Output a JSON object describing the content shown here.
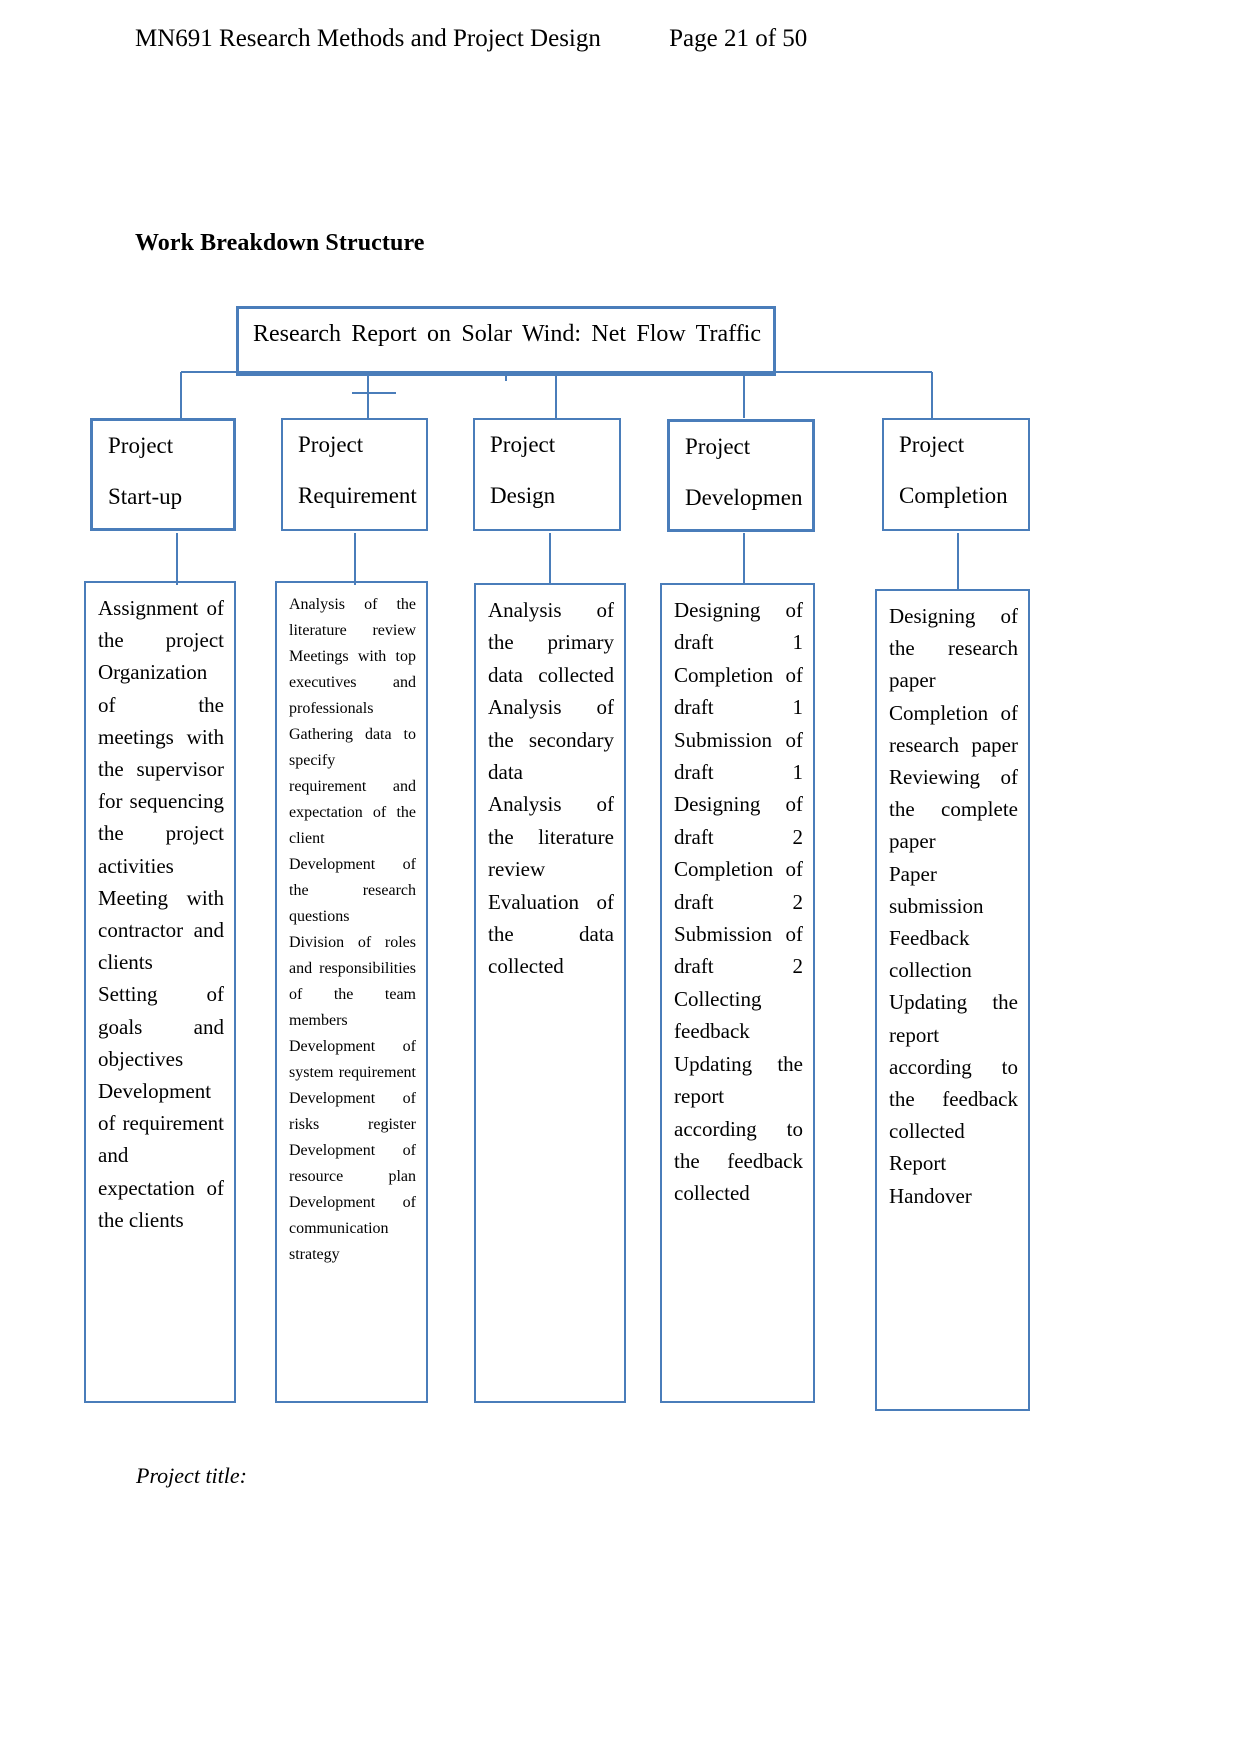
{
  "header": {
    "course": "MN691 Research Methods and Project Design",
    "page_label": "Page 21 of 50"
  },
  "heading": "Work Breakdown Structure",
  "footer": "Project title:",
  "colors": {
    "box_border": "#4a7dba",
    "connector": "#4a7dba",
    "text": "#000000",
    "page_background": "#ffffff"
  },
  "diagram": {
    "type": "work-breakdown-structure",
    "root": {
      "label": "Research Report on Solar Wind: Net Flow Traffic"
    },
    "phases": [
      {
        "title_line1": "Project",
        "title_line2": "Start-up",
        "tasks": [
          "Assignment of the project",
          "Organization of the meetings with the supervisor for sequencing the project activities",
          "Meeting with contractor and clients",
          "Setting of goals and objectives",
          "Development of requirement and expectation of the clients"
        ]
      },
      {
        "title_line1": "Project",
        "title_line2": "Requirement",
        "tasks": [
          "Analysis of the literature review",
          "Meetings with top executives and professionals",
          "Gathering data to specify requirement and expectation of the client",
          "Development of the research questions",
          "Division of roles and responsibilities of the team members",
          "Development of system requirement",
          "Development of risks register",
          "Development of resource plan",
          "Development of communication strategy"
        ]
      },
      {
        "title_line1": "Project",
        "title_line2": "Design",
        "tasks": [
          "Analysis of the primary data collected",
          "Analysis of the secondary data",
          "Analysis of the literature review",
          "Evaluation of the data collected"
        ]
      },
      {
        "title_line1": "Project",
        "title_line2": "Developmen",
        "tasks": [
          "Designing of draft 1",
          "Completion of draft 1",
          "Submission of draft 1",
          "Designing of draft 2",
          "Completion of draft 2",
          "Submission of draft 2",
          "Collecting feedback",
          "Updating the report according to the feedback collected"
        ]
      },
      {
        "title_line1": "Project",
        "title_line2": "Completion",
        "tasks": [
          "Designing of the research paper",
          "Completion of research paper",
          "Reviewing of the complete paper",
          "Paper submission",
          "Feedback collection",
          "Updating the report according to the feedback collected",
          "Report Handover"
        ]
      }
    ]
  }
}
